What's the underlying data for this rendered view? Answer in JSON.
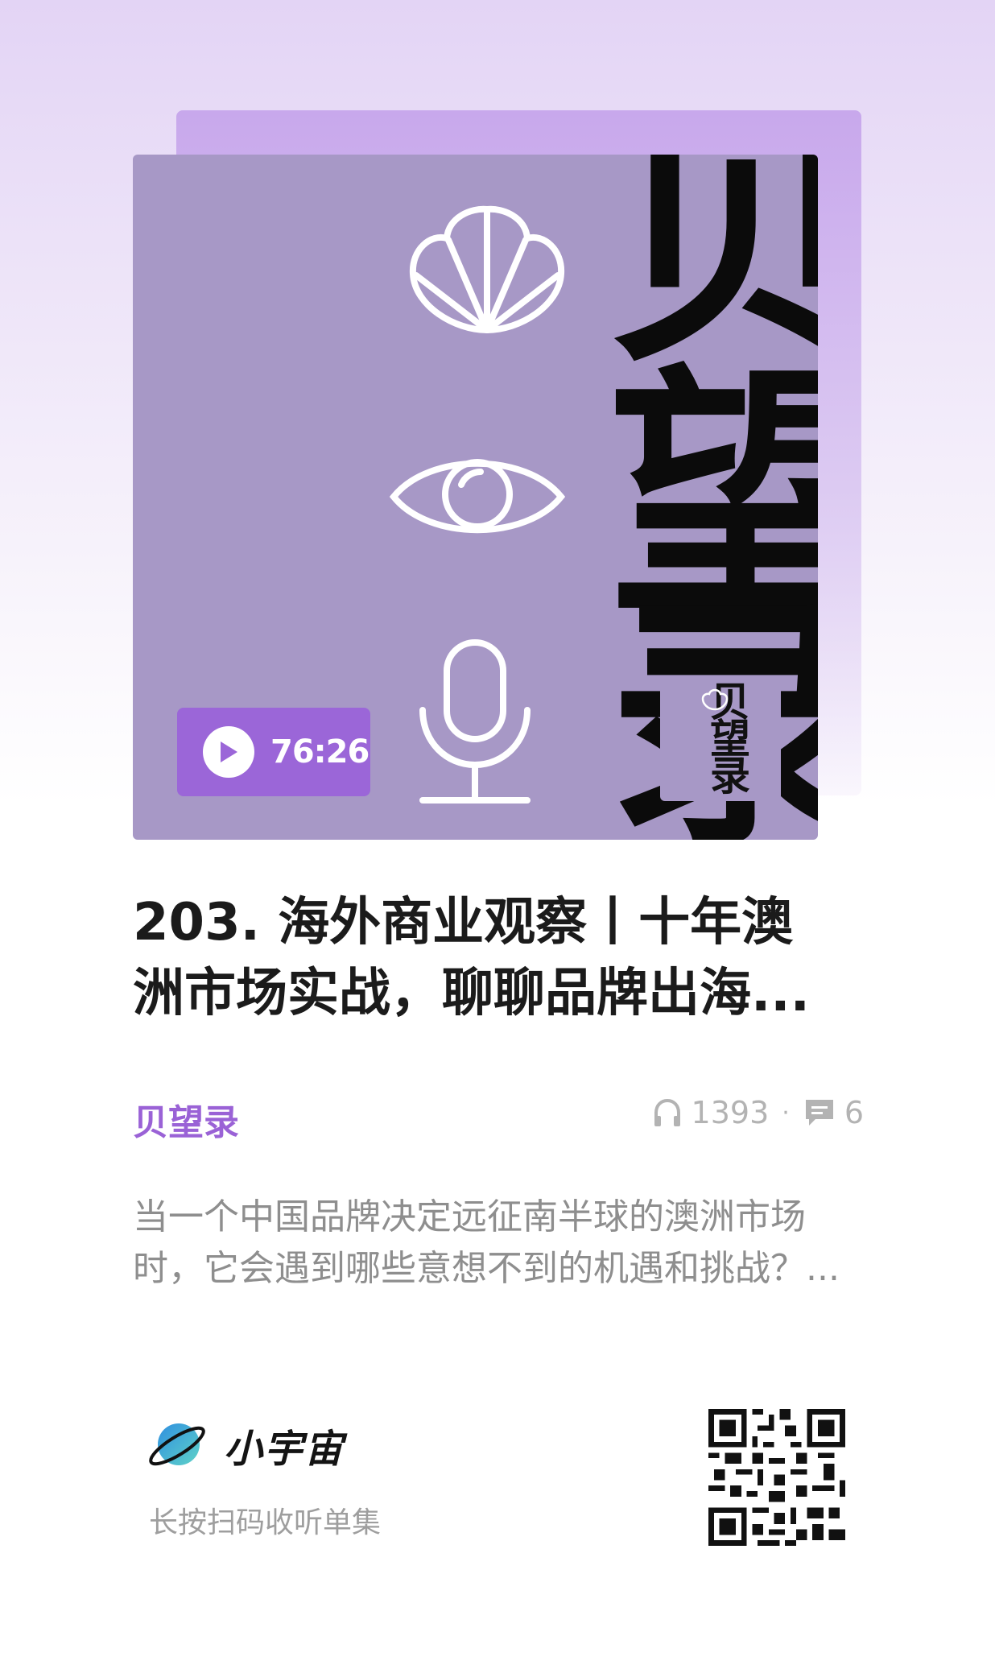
{
  "cover": {
    "char1": "贝",
    "char2": "望",
    "char3": "录",
    "duration": "76:26"
  },
  "episode": {
    "title": "203. 海外商业观察丨十年澳洲市场实战，聊聊品牌出海...",
    "podcast_name": "贝望录",
    "plays": "1393",
    "comments": "6",
    "description": "当一个中国品牌决定远征南半球的澳洲市场时，它会遇到哪些意想不到的机遇和挑战？..."
  },
  "footer": {
    "brand_name": "小宇宙",
    "scan_hint": "长按扫码收听单集"
  },
  "colors": {
    "accent": "#9b66d8",
    "cover_bg": "#a798c6"
  }
}
